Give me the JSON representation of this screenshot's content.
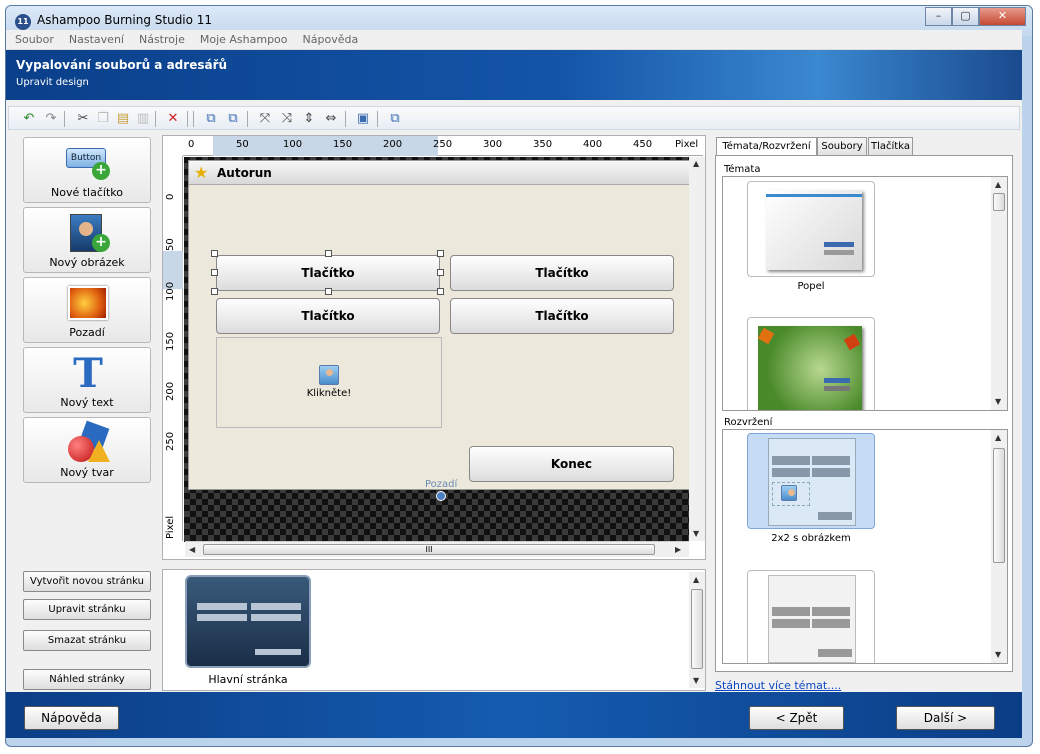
{
  "window": {
    "title": "Ashampoo Burning Studio 11",
    "app_icon": "11"
  },
  "menu": [
    "Soubor",
    "Nastavení",
    "Nástroje",
    "Moje Ashampoo",
    "Nápověda"
  ],
  "banner": {
    "title": "Vypalování souborů a adresářů",
    "subtitle": "Upravit design"
  },
  "toolbar_icons": [
    "undo-icon",
    "redo-icon",
    "cut-icon",
    "copy-icon",
    "paste-icon",
    "paste-special-icon",
    "delete-icon",
    "bring-front-icon",
    "send-back-icon",
    "align-left-icon",
    "align-right-icon",
    "align-vcenter-icon",
    "align-hcenter-icon",
    "picture-icon",
    "duplicate-icon"
  ],
  "left_tools": [
    {
      "label": "Nové tlačítko",
      "icon": "new-button-icon",
      "icon_text": "Button"
    },
    {
      "label": "Nový obrázek",
      "icon": "new-image-icon"
    },
    {
      "label": "Pozadí",
      "icon": "background-icon"
    },
    {
      "label": "Nový text",
      "icon": "text-icon",
      "icon_text": "T"
    },
    {
      "label": "Nový tvar",
      "icon": "shape-icon"
    }
  ],
  "page_buttons": [
    "Vytvořit novou stránku",
    "Upravit stránku",
    "Smazat stránku",
    "Náhled stránky"
  ],
  "ruler": {
    "h_labels": [
      "0",
      "50",
      "100",
      "150",
      "200",
      "250",
      "300",
      "350",
      "400",
      "450",
      "Pixel"
    ],
    "v_labels": [
      "0",
      "50",
      "100",
      "150",
      "200",
      "250"
    ],
    "v_unit": "Pixel"
  },
  "canvas": {
    "title": "Autorun",
    "buttons": [
      "Tlačítko",
      "Tlačítko",
      "Tlačítko",
      "Tlačítko"
    ],
    "image_label": "Klikněte!",
    "exit_button": "Konec",
    "background_label": "Pozadí"
  },
  "pages": [
    {
      "label": "Hlavní stránka"
    }
  ],
  "right_tabs": [
    "Témata/Rozvržení",
    "Soubory",
    "Tlačítka"
  ],
  "themes": {
    "header": "Témata",
    "items": [
      {
        "label": "Popel"
      },
      {
        "label": ""
      }
    ]
  },
  "layouts": {
    "header": "Rozvržení",
    "items": [
      {
        "label": "2x2 s obrázkem"
      },
      {
        "label": ""
      }
    ]
  },
  "download_link": "Stáhnout více témat....",
  "footer": {
    "help": "Nápověda",
    "back": "< Zpět",
    "next": "Další >"
  },
  "colors": {
    "banner": "#1455a8",
    "accent": "#0b46c4",
    "selection": "#c7d7e8"
  }
}
